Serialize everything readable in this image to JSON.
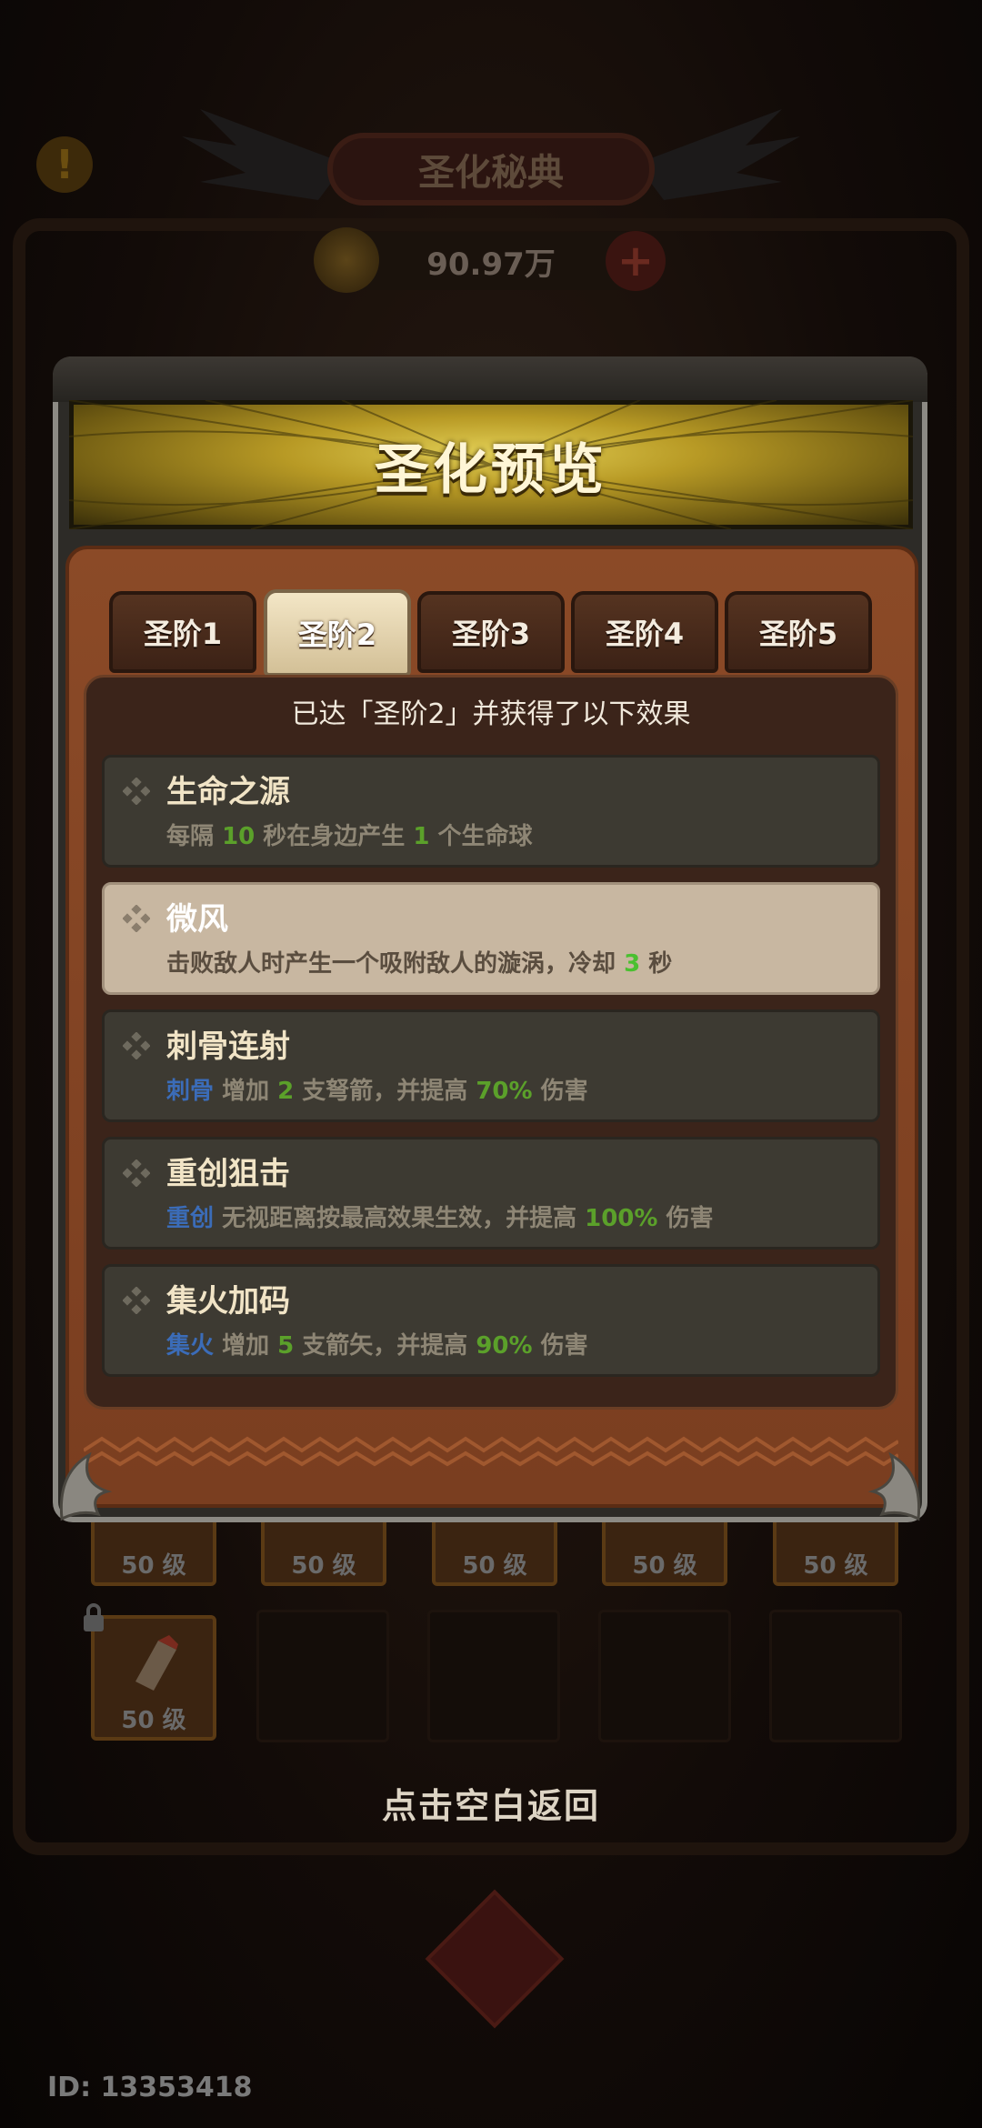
{
  "background": {
    "screen_title": "圣化秘典",
    "currency_amount": "90.97万",
    "alert_icon": "exclamation-icon",
    "plus_icon": "plus-icon",
    "item_level_label": "50 级",
    "close_hint": "点击空白返回",
    "player_id": "ID: 13353418"
  },
  "dialog": {
    "title": "圣化预览",
    "tabs": [
      {
        "label": "圣阶1",
        "active": false
      },
      {
        "label": "圣阶2",
        "active": true
      },
      {
        "label": "圣阶3",
        "active": false
      },
      {
        "label": "圣阶4",
        "active": false
      },
      {
        "label": "圣阶5",
        "active": false
      }
    ],
    "status_text": "已达「圣阶2」并获得了以下效果",
    "effects": [
      {
        "title": "生命之源",
        "desc_parts": [
          "每隔 ",
          "10",
          " 秒在身边产生 ",
          "1",
          " 个生命球"
        ]
      },
      {
        "title": "微风",
        "desc_parts": [
          "击败敌人时产生一个吸附敌人的漩涡，冷却 ",
          "3",
          " 秒"
        ]
      },
      {
        "title": "刺骨连射",
        "desc_parts": [
          "刺骨",
          " 增加 ",
          "2",
          " 支弩箭，并提高 ",
          "70%",
          " 伤害"
        ]
      },
      {
        "title": "重创狙击",
        "desc_parts": [
          "重创",
          " 无视距离按最高效果生效，并提高 ",
          "100%",
          " 伤害"
        ]
      },
      {
        "title": "集火加码",
        "desc_parts": [
          "集火",
          " 增加 ",
          "5",
          " 支箭矢，并提高 ",
          "90%",
          " 伤害"
        ]
      }
    ]
  },
  "colors": {
    "highlight_value": "#5ba02a",
    "keyword_blue": "#3b6cb8",
    "banner_gold": "#c9ad2e",
    "panel_brown": "#8b4a27"
  }
}
